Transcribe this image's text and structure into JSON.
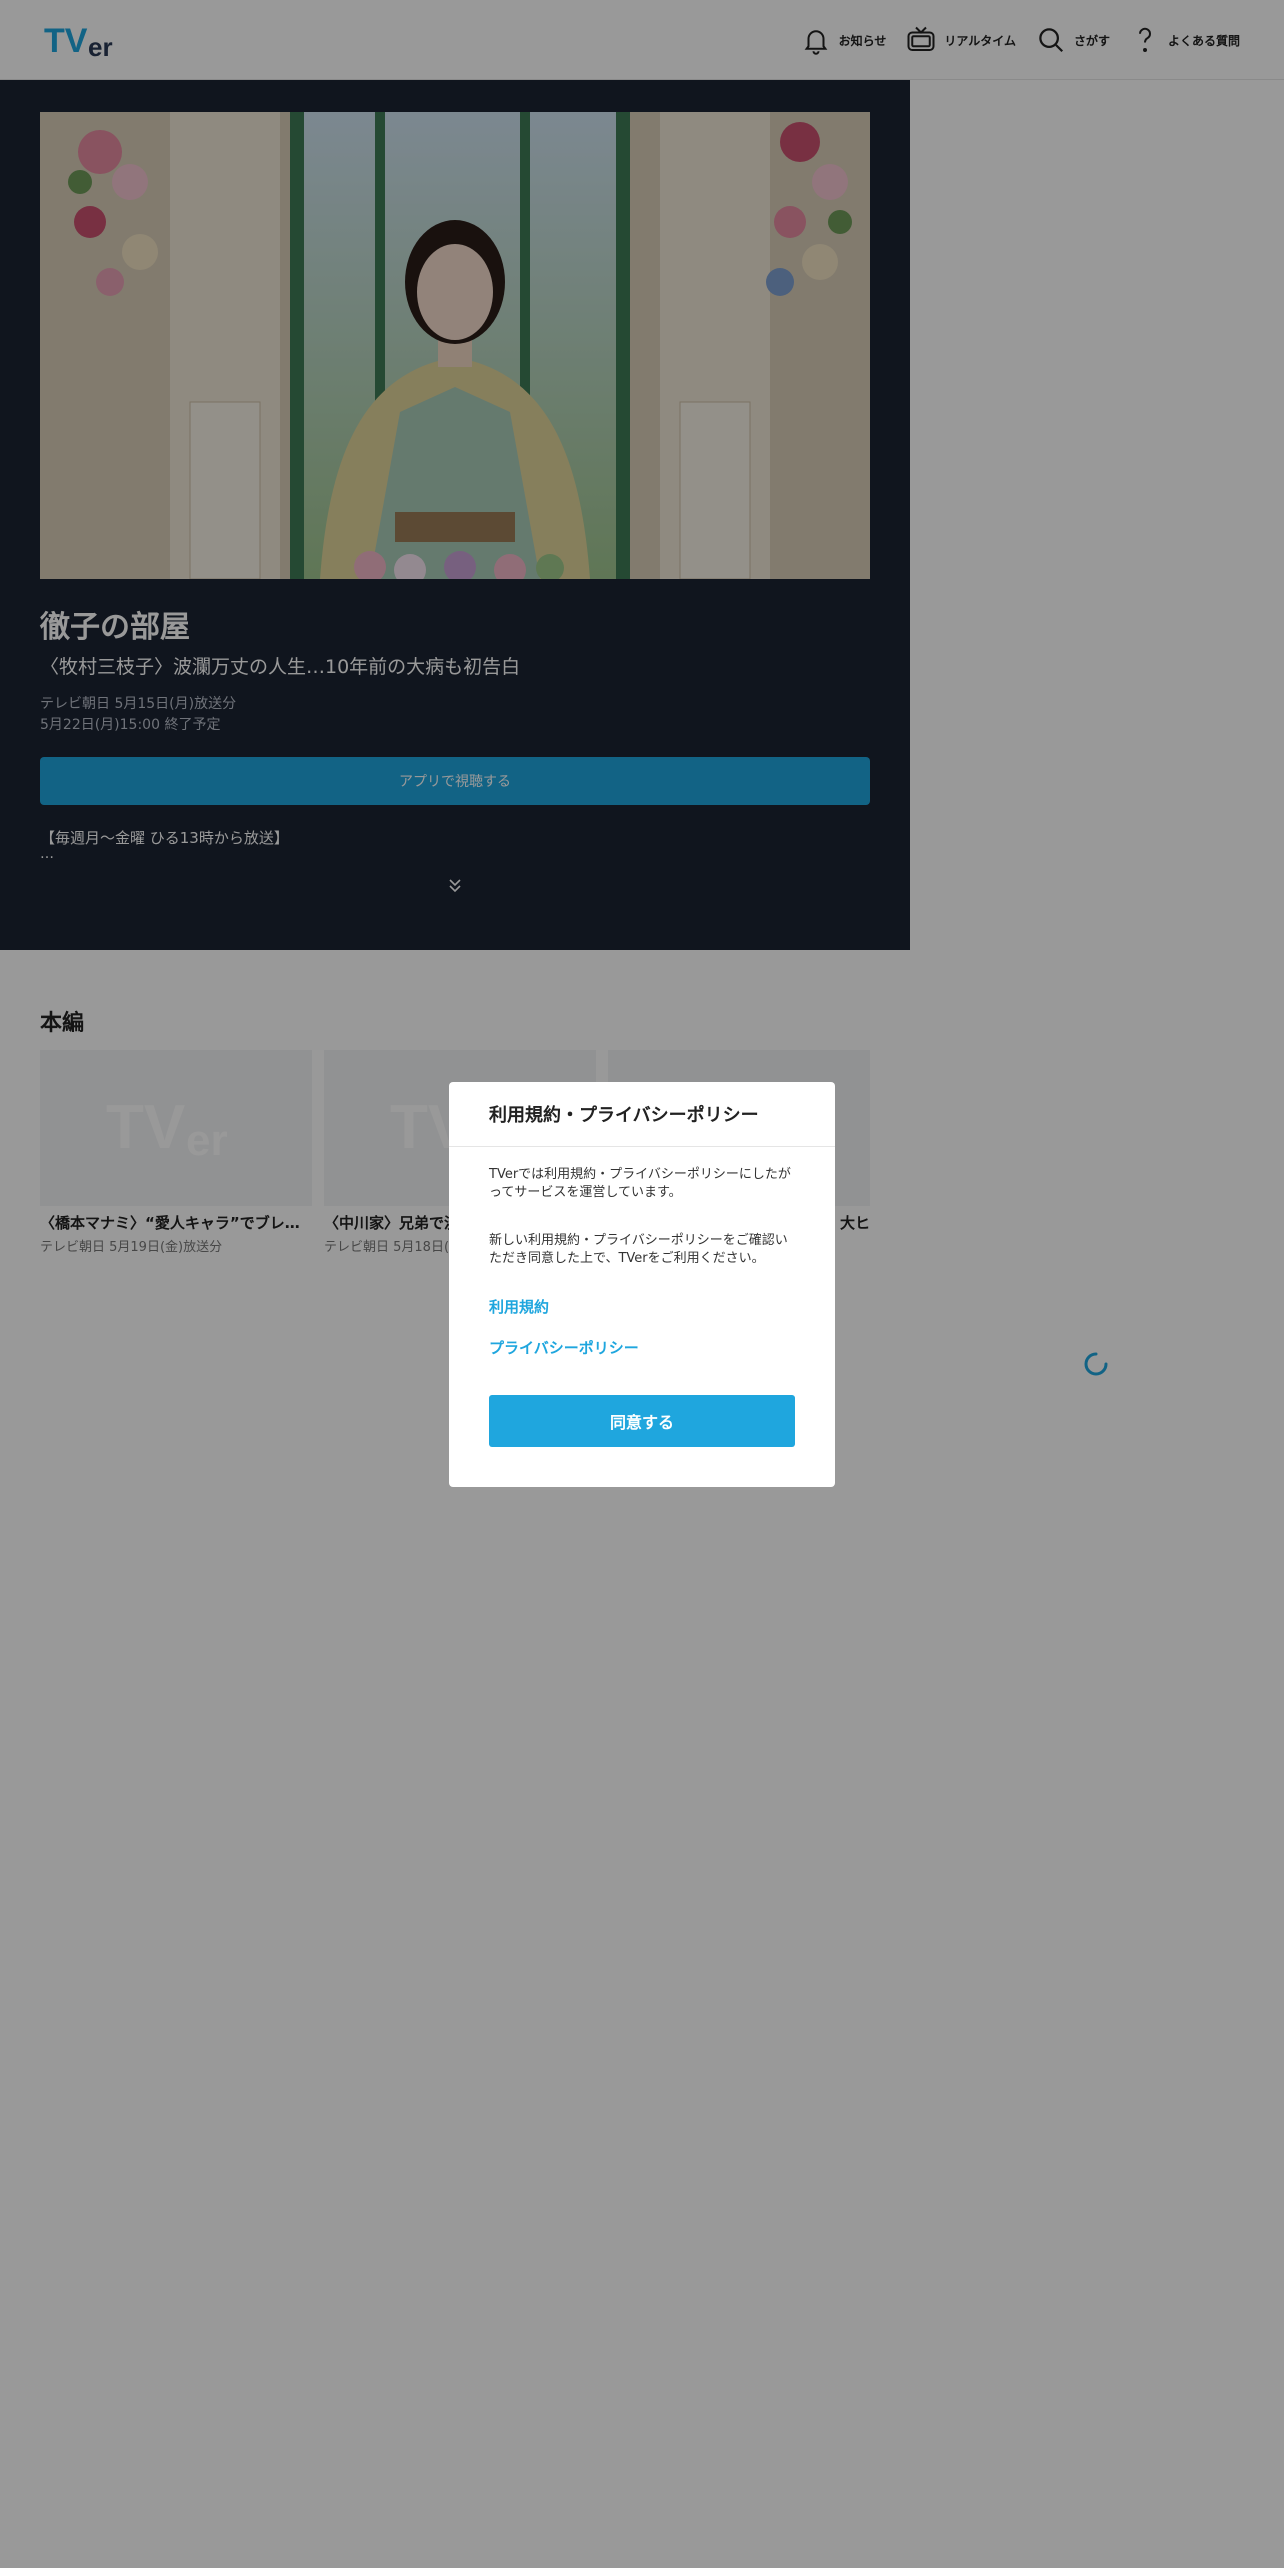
{
  "header": {
    "logo_text": "TVer",
    "nav": [
      {
        "label": "お知らせ",
        "icon": "bell-icon"
      },
      {
        "label": "リアルタイム",
        "icon": "tv-icon"
      },
      {
        "label": "さがす",
        "icon": "search-icon"
      },
      {
        "label": "よくある質問",
        "icon": "question-icon"
      }
    ]
  },
  "hero": {
    "title": "徹子の部屋",
    "subtitle": "〈牧村三枝子〉波瀾万丈の人生…10年前の大病も初告白",
    "broadcast": "テレビ朝日 5月15日(月)放送分",
    "end": "5月22日(月)15:00 終了予定",
    "app_button": "アプリで視聴する",
    "description": "【毎週月～金曜 ひる13時から放送】",
    "ellipsis": "…"
  },
  "section": {
    "title": "本編",
    "cards": [
      {
        "title": "〈橋本マナミ〉“愛人キャラ”でブレ…",
        "meta": "テレビ朝日 5月19日(金)放送分"
      },
      {
        "title": "〈中川家〉兄弟で漫",
        "meta": "テレビ朝日 5月18日("
      },
      {
        "title": "大ヒ",
        "meta": ""
      }
    ]
  },
  "modal": {
    "title": "利用規約・プライバシーポリシー",
    "p1": "TVerでは利用規約・プライバシーポリシーにしたがってサービスを運営しています。",
    "p2": "新しい利用規約・プライバシーポリシーをご確認いただき同意した上で、TVerをご利用ください。",
    "link_terms": "利用規約",
    "link_privacy": "プライバシーポリシー",
    "agree_button": "同意する"
  },
  "colors": {
    "accent": "#1fa6de",
    "hero_bg": "#1b2333",
    "overlay": "rgba(0,0,0,0.40)"
  }
}
